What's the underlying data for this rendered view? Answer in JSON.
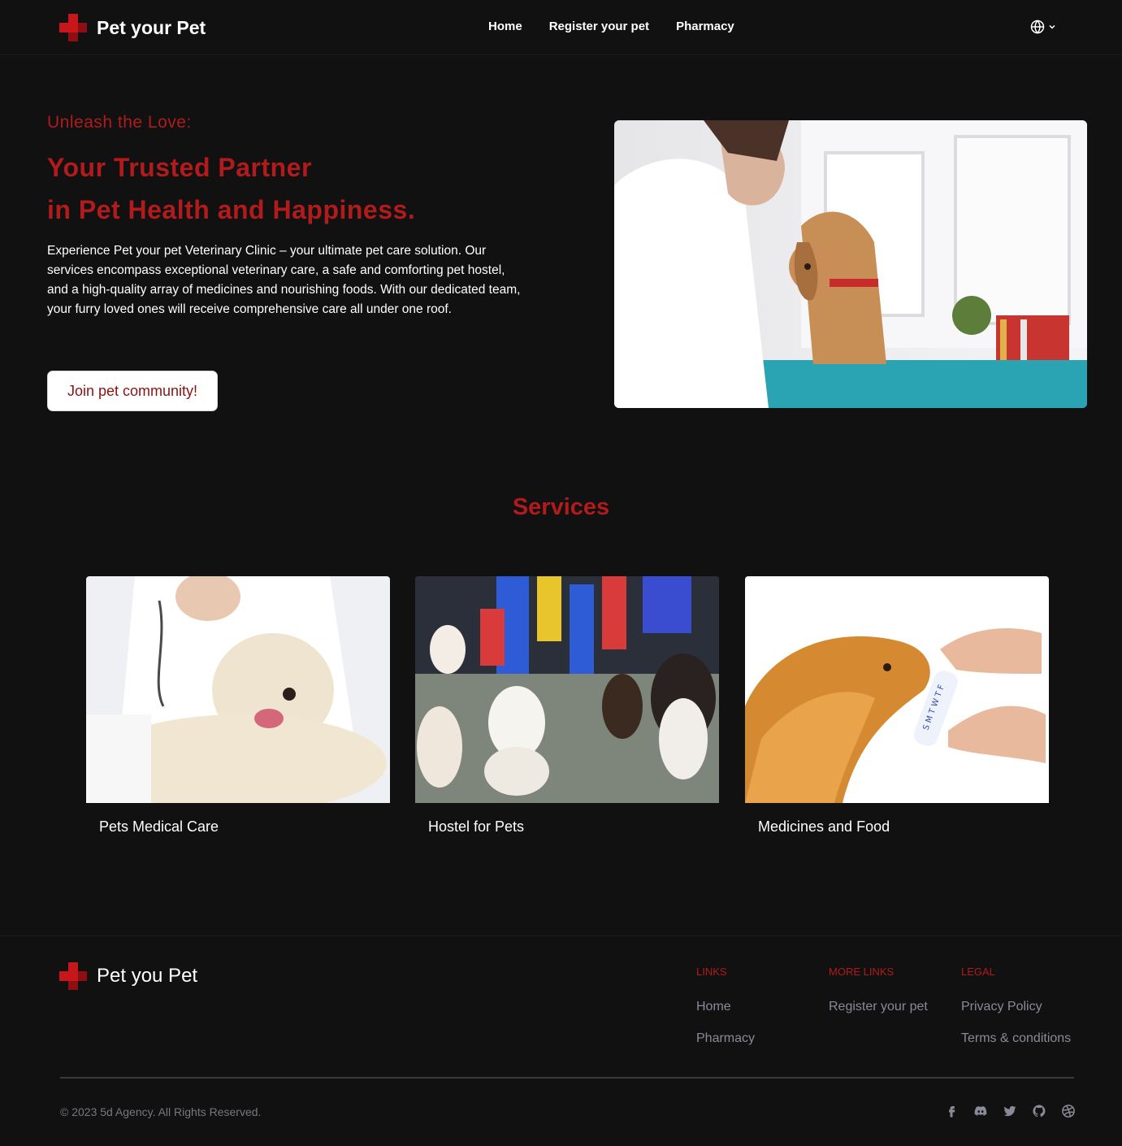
{
  "header": {
    "brand": "Pet your Pet",
    "nav": [
      "Home",
      "Register your pet",
      "Pharmacy"
    ],
    "lang_icon": "globe-icon"
  },
  "hero": {
    "eyebrow": "Unleash the Love:",
    "title_line1": "Your Trusted Partner",
    "title_line2": "in Pet Health and Happiness.",
    "description": "Experience Pet your pet Veterinary Clinic – your ultimate pet care solution. Our services encompass exceptional veterinary care, a safe and comforting pet hostel, and a high-quality array of medicines and nourishing foods. With our dedicated team, your furry loved ones will receive comprehensive care all under one roof.",
    "cta": "Join pet community!"
  },
  "services": {
    "title": "Services",
    "items": [
      {
        "label": "Pets Medical Care"
      },
      {
        "label": "Hostel for Pets"
      },
      {
        "label": "Medicines and Food"
      }
    ]
  },
  "footer": {
    "brand": "Pet you Pet",
    "columns": [
      {
        "heading": "LINKS",
        "links": [
          "Home",
          "Pharmacy"
        ]
      },
      {
        "heading": "MORE LINKS",
        "links": [
          "Register your pet"
        ]
      },
      {
        "heading": "LEGAL",
        "links": [
          "Privacy Policy",
          "Terms & conditions"
        ]
      }
    ],
    "copyright": "© 2023 5d Agency. All Rights Reserved.",
    "social": [
      "facebook-icon",
      "discord-icon",
      "twitter-icon",
      "github-icon",
      "dribbble-icon"
    ]
  },
  "colors": {
    "background": "#111111",
    "accent": "#b11b1b",
    "cta_text": "#8e1111",
    "muted_link": "#8a8a98"
  }
}
